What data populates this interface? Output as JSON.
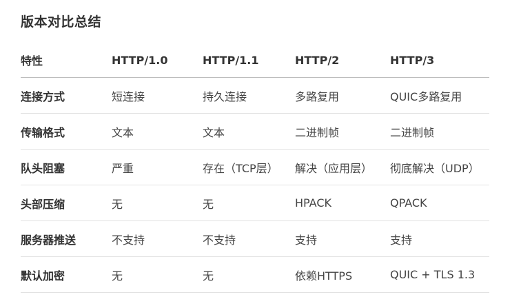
{
  "title": "版本对比总结",
  "table": {
    "headers": [
      "特性",
      "HTTP/1.0",
      "HTTP/1.1",
      "HTTP/2",
      "HTTP/3"
    ],
    "rows": [
      [
        "连接方式",
        "短连接",
        "持久连接",
        "多路复用",
        "QUIC多路复用"
      ],
      [
        "传输格式",
        "文本",
        "文本",
        "二进制帧",
        "二进制帧"
      ],
      [
        "队头阻塞",
        "严重",
        "存在（TCP层）",
        "解决（应用层）",
        "彻底解决（UDP）"
      ],
      [
        "头部压缩",
        "无",
        "无",
        "HPACK",
        "QPACK"
      ],
      [
        "服务器推送",
        "不支持",
        "不支持",
        "支持",
        "支持"
      ],
      [
        "默认加密",
        "无",
        "无",
        "依赖HTTPS",
        "QUIC + TLS 1.3"
      ]
    ]
  }
}
